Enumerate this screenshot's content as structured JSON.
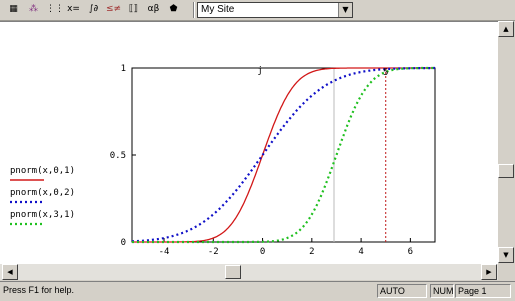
{
  "toolbar": {
    "combo_value": "My Site",
    "icons": [
      "calculator-icon",
      "graph-icon",
      "matrix-icon",
      "evaluation-icon",
      "calculus-icon",
      "boolean-icon",
      "programming-icon",
      "greek-icon",
      "symbolic-icon"
    ],
    "glyphs": [
      "▦",
      "⁂",
      "⋮⋮",
      "x=",
      "∫∂",
      "≤≠",
      "⟦⟧",
      "αβ",
      "⬟"
    ]
  },
  "legend": [
    {
      "label": "pnorm(x,0,1)",
      "color": "#d21818",
      "dash": "solid"
    },
    {
      "label": "pnorm(x,0,2)",
      "color": "#1010c8",
      "dash": "dot"
    },
    {
      "label": "pnorm(x,3,1)",
      "color": "#20c020",
      "dash": "dot"
    }
  ],
  "plot": {
    "top_label": "j",
    "marker_label": "5",
    "marker_x": 5,
    "marker_color": "#c01818"
  },
  "chart_data": {
    "type": "line",
    "x_ticks": [
      "-4",
      "-2",
      "0",
      "2",
      "4",
      "6"
    ],
    "y_ticks": [
      "0",
      "0.5",
      "1"
    ],
    "xlim": [
      -5.3,
      7
    ],
    "ylim": [
      0,
      1
    ],
    "series": [
      {
        "name": "pnorm(x,0,1)",
        "mu": 0,
        "sigma": 1
      },
      {
        "name": "pnorm(x,0,2)",
        "mu": 0,
        "sigma": 2
      },
      {
        "name": "pnorm(x,3,1)",
        "mu": 3,
        "sigma": 1
      }
    ]
  },
  "status": {
    "help": "Press F1 for help.",
    "mode": "AUTO",
    "num": "NUM",
    "page": "Page 1"
  }
}
